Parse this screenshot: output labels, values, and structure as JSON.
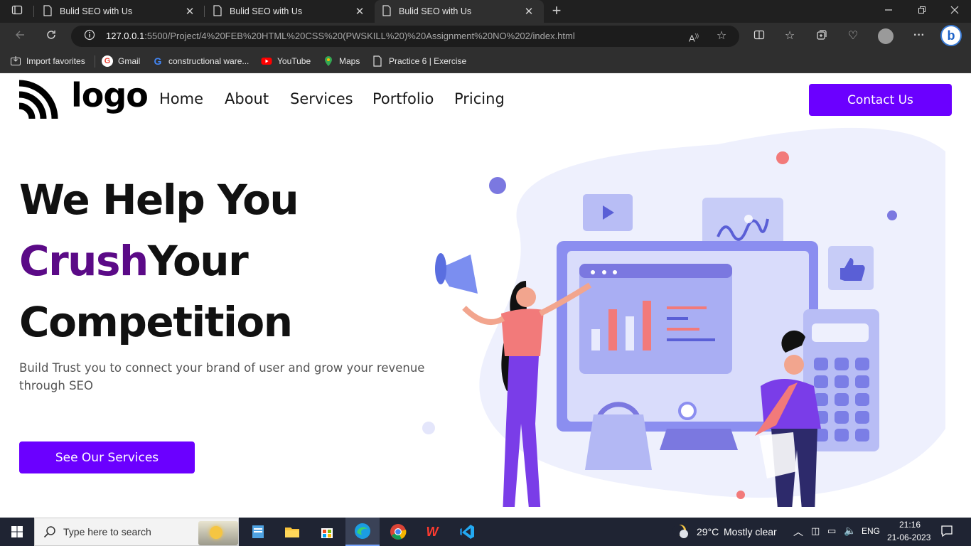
{
  "browser": {
    "tabs": [
      {
        "title": "Bulid SEO with Us",
        "active": false
      },
      {
        "title": "Bulid SEO with Us",
        "active": false
      },
      {
        "title": "Bulid SEO with Us",
        "active": true
      }
    ],
    "new_tab_icon": "plus-icon",
    "url_host": "127.0.0.1",
    "url_rest": ":5500/Project/4%20FEB%20HTML%20CSS%20(PWSKILL%20)%20Assignment%20NO%202/index.html",
    "favorites": [
      {
        "label": "Import favorites",
        "icon": "import-icon"
      },
      {
        "label": "Gmail",
        "icon": "gmail-icon"
      },
      {
        "label": "constructional ware...",
        "icon": "google-icon"
      },
      {
        "label": "YouTube",
        "icon": "youtube-icon"
      },
      {
        "label": "Maps",
        "icon": "maps-icon"
      },
      {
        "label": "Practice 6 | Exercise",
        "icon": "page-icon"
      }
    ]
  },
  "site": {
    "logo_text": "logo",
    "nav": [
      "Home",
      "About",
      "Services",
      "Portfolio",
      "Pricing"
    ],
    "contact_label": "Contact Us",
    "hero": {
      "line1": "We Help You",
      "crush": "Crush",
      "your": "Your",
      "line3": "Competition",
      "subtitle": "Build Trust you to connect your brand of user and grow your revenue through SEO",
      "cta_label": "See Our Services"
    },
    "colors": {
      "primary": "#6b00ff",
      "accent_purple": "#5b0a87",
      "illustration": "#7b78e0"
    }
  },
  "taskbar": {
    "search_placeholder": "Type here to search",
    "weather_temp": "29°C",
    "weather_desc": "Mostly clear",
    "language": "ENG",
    "time": "21:16",
    "date": "21-06-2023"
  }
}
